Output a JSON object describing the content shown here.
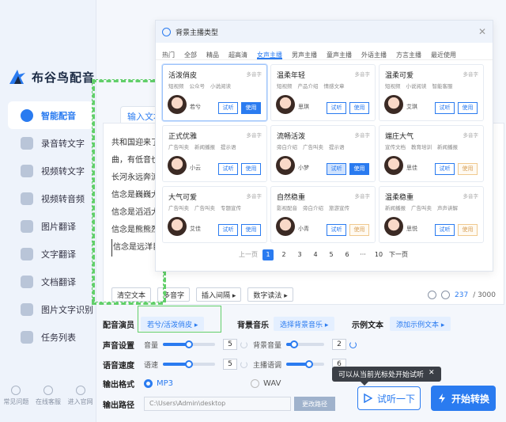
{
  "app": {
    "name": "布谷鸟配音"
  },
  "sidebar": {
    "items": [
      {
        "label": "智能配音",
        "icon": "mic-icon",
        "active": true
      },
      {
        "label": "录音转文字",
        "icon": "audio-file-icon"
      },
      {
        "label": "视频转文字",
        "icon": "video-file-icon"
      },
      {
        "label": "视频转音频",
        "icon": "video-audio-icon"
      },
      {
        "label": "图片翻译",
        "icon": "image-icon"
      },
      {
        "label": "文字翻译",
        "icon": "translate-icon"
      },
      {
        "label": "文档翻译",
        "icon": "document-icon"
      },
      {
        "label": "图片文字识别",
        "icon": "ocr-icon"
      },
      {
        "label": "任务列表",
        "icon": "list-icon"
      }
    ],
    "footer": [
      {
        "label": "常见问题",
        "icon": "help-icon"
      },
      {
        "label": "在线客服",
        "icon": "chat-icon"
      },
      {
        "label": "进入官网",
        "icon": "home-icon"
      }
    ]
  },
  "editor": {
    "tab_label": "输入文本",
    "lines": [
      "共和国迎来了",
      "曲，有低音也",
      "长河永远奔流，",
      "信念是巍巍大",
      "信念是滔滔大",
      "信念是熊熊烈",
      "信念是远洋巨"
    ],
    "tools": [
      "清空文本",
      "多音字",
      "插入间隔 ▸",
      "数字读法 ▸"
    ],
    "count_current": "237",
    "count_total": "/ 3000"
  },
  "settings": {
    "voice_label": "配音演员",
    "voice_value": "若兮/活泼俏皮 ▸",
    "bgm_label": "背景音乐",
    "bgm_value": "选择背景音乐 ▸",
    "sample_label": "示例文本",
    "sample_value": "添加示例文本 ▸",
    "sound_label": "声音设置",
    "volume_label": "音量",
    "volume_value": "5",
    "volume_level": 0.5,
    "bg_volume_label": "背景音量",
    "bg_volume_value": "2",
    "bg_volume_level": 0.2,
    "speed_label": "语音速度",
    "speed_sub": "语速",
    "speed_value": "5",
    "speed_level": 0.5,
    "tone_label": "主播语调",
    "tone_value": "6",
    "tone_level": 0.6,
    "format_label": "输出格式",
    "format_mp3": "MP3",
    "format_wav": "WAV",
    "path_label": "输出路径",
    "path_value": "C:\\Users\\Admin\\desktop",
    "path_button": "更改路径",
    "tooltip": "可以从当前光标处开始试听",
    "tooltip_close": "✕",
    "listen_button": "试听一下",
    "start_button": "开始转换"
  },
  "popup": {
    "title": "背景主播类型",
    "close": "✕",
    "categories": [
      "热门",
      "全部",
      "精品",
      "超高清",
      "女声主播",
      "男声主播",
      "童声主播",
      "外语主播",
      "方言主播",
      "最近使用"
    ],
    "active_category": "女声主播",
    "try_label": "试听",
    "use_label": "使用",
    "multi_label": "多音字",
    "cards": [
      {
        "name": "活泼俏皮",
        "tags": [
          "短视频",
          "公众号",
          "小说阅读"
        ],
        "voice": "若兮",
        "selected": true,
        "use": "primary"
      },
      {
        "name": "温柔年轻",
        "tags": [
          "短视频",
          "产品介绍",
          "情感文章"
        ],
        "voice": "思琪",
        "use": "normal"
      },
      {
        "name": "温柔可爱",
        "tags": [
          "短视频",
          "小说阅读",
          "智能客服"
        ],
        "voice": "艾琪",
        "use": "normal"
      },
      {
        "name": "正式优雅",
        "tags": [
          "广告叫卖",
          "新闻播报",
          "提示语"
        ],
        "voice": "小云",
        "use": "normal"
      },
      {
        "name": "流畅活泼",
        "tags": [
          "旁白介绍",
          "广告叫卖",
          "提示语"
        ],
        "voice": "小梦",
        "use": "primary",
        "hover": true
      },
      {
        "name": "端庄大气",
        "tags": [
          "宣传文档",
          "教育培训",
          "新闻播报"
        ],
        "voice": "思佳",
        "use": "vip"
      },
      {
        "name": "大气可爱",
        "tags": [
          "广告叫卖",
          "广告叫卖",
          "专题宣传"
        ],
        "voice": "艾佳",
        "use": "normal"
      },
      {
        "name": "自然稳重",
        "tags": [
          "影视配音",
          "旁白介绍",
          "旅游宣传"
        ],
        "voice": "小青",
        "use": "vip"
      },
      {
        "name": "温柔稳重",
        "tags": [
          "新闻播报",
          "广告叫卖",
          "声声讲解"
        ],
        "voice": "思悦",
        "use": "vip"
      }
    ],
    "pager": {
      "prev": "上一页",
      "pages": [
        "1",
        "2",
        "3",
        "4",
        "5",
        "6",
        "···",
        "10"
      ],
      "active": "1",
      "next": "下一页"
    }
  },
  "colors": {
    "accent": "#2a7bf0",
    "guide": "#62cf6a"
  }
}
